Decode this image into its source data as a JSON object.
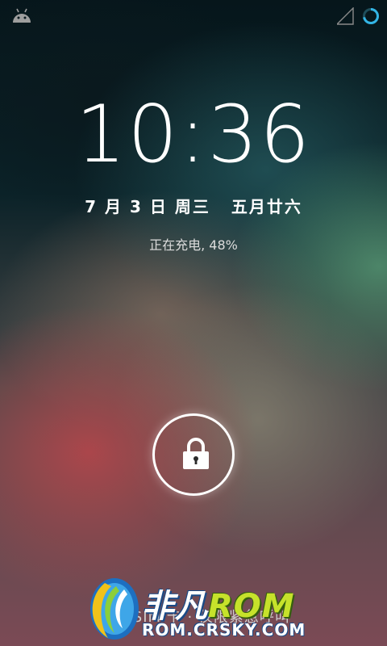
{
  "status_bar": {
    "left_icon": "android-debug-icon",
    "signal_icon": "signal-empty-icon",
    "battery_icon": "battery-charging-circle-icon"
  },
  "clock": {
    "time": "10:36"
  },
  "date": {
    "gregorian": "7 月 3 日 周三",
    "lunar": "五月廿六"
  },
  "status": {
    "charging": "正在充电, 48%"
  },
  "unlock": {
    "icon": "lock-icon"
  },
  "bottom": {
    "text": "没有 SIM 卡 · 仅限紧急呼叫"
  },
  "watermark": {
    "name_part": "非凡",
    "rom_part": "ROM",
    "url": "ROM.CRSKY.COM"
  },
  "colors": {
    "accent": "#33b5e5",
    "text": "#ffffff",
    "watermark_green": "#c6e22b"
  }
}
